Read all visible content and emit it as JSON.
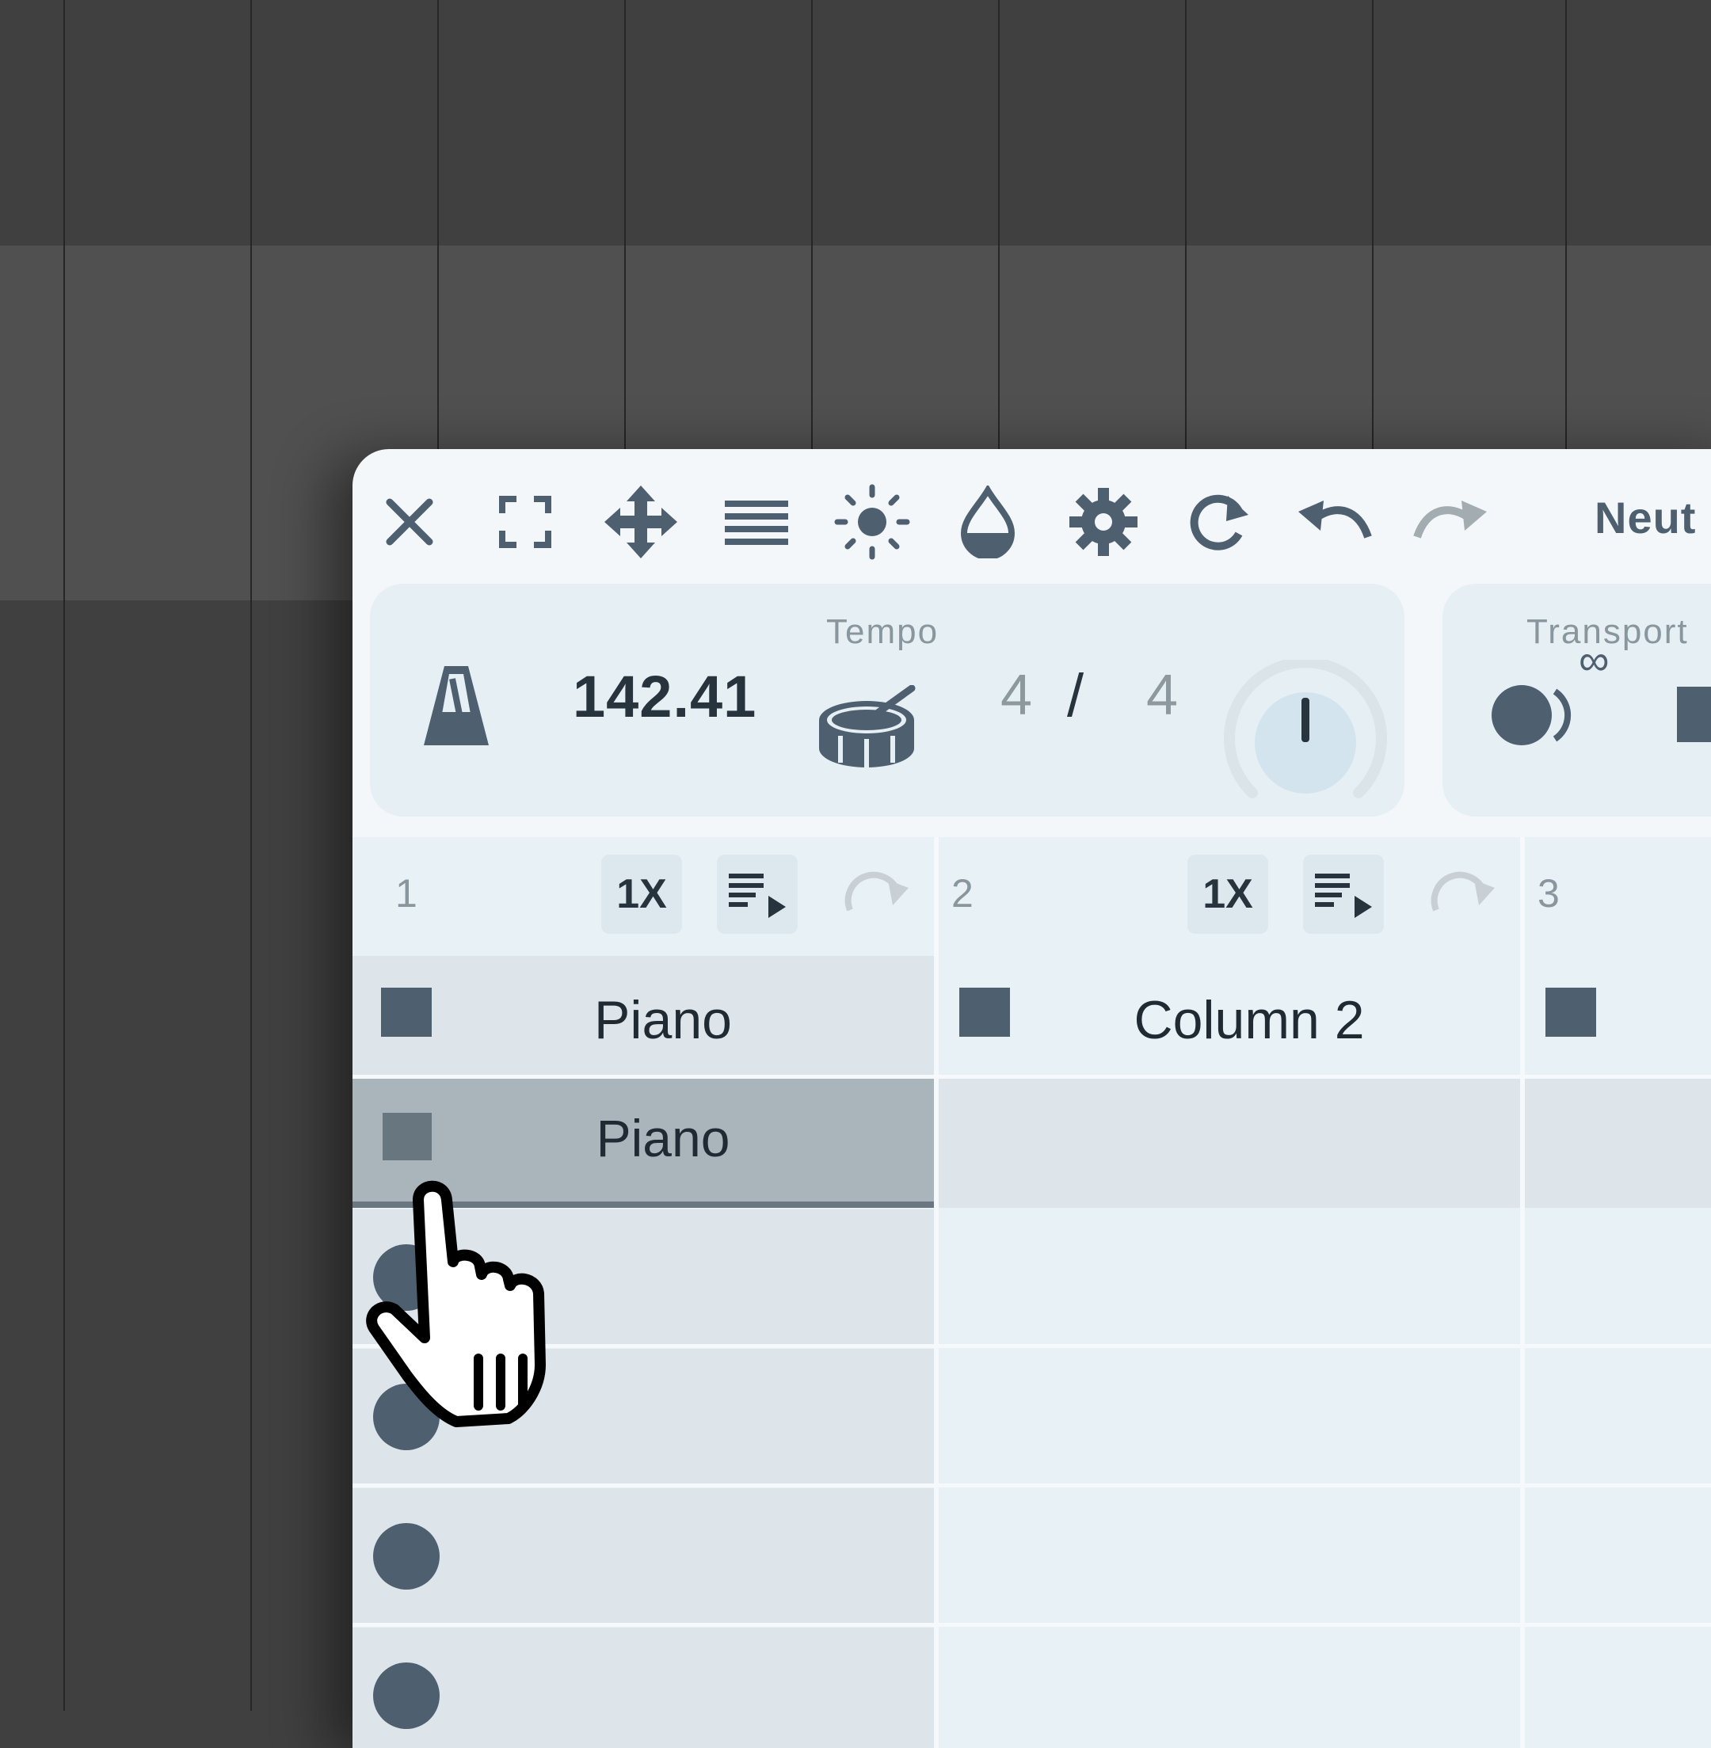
{
  "toolbar": {
    "icons": [
      "close-icon",
      "fullscreen-icon",
      "move-icon",
      "menu-icon",
      "brightness-icon",
      "color-icon",
      "settings-icon",
      "reload-icon",
      "undo-icon",
      "redo-icon"
    ],
    "preset_name": "Neut"
  },
  "tempo_panel": {
    "title": "Tempo",
    "bpm": "142.41",
    "time_sig_num": "4",
    "time_sig_sep": "/",
    "time_sig_den": "4"
  },
  "transport_panel": {
    "title": "Transport",
    "loop_symbol": "∞"
  },
  "columns": [
    {
      "number": "1",
      "rate": "1X",
      "title": "Piano",
      "clips": [
        "Piano",
        "",
        "",
        "",
        ""
      ]
    },
    {
      "number": "2",
      "rate": "1X",
      "title": "Column 2",
      "clips": [
        "",
        "",
        "",
        "",
        ""
      ]
    },
    {
      "number": "3",
      "rate": "",
      "title": "",
      "clips": [
        "",
        "",
        "",
        "",
        ""
      ]
    }
  ],
  "colors": {
    "accent": "#4e6070",
    "panel_bg": "#e6eff4",
    "selected_clip": "#a9b5bb",
    "daw_background": "#404040"
  }
}
